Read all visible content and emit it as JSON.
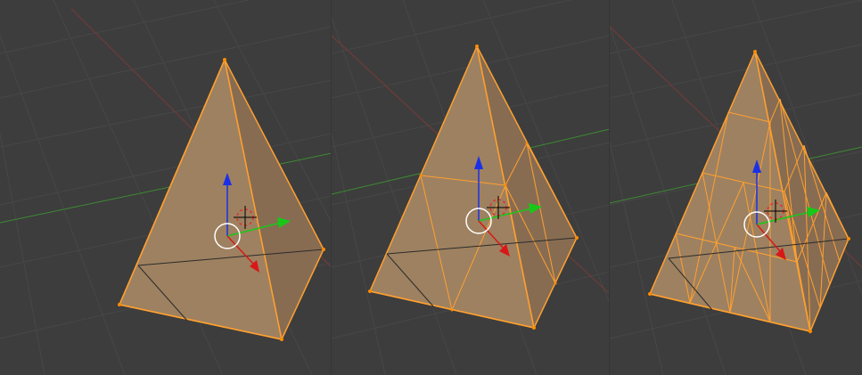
{
  "viewports": [
    {
      "id": "viewport-1",
      "subdivision_level": 0
    },
    {
      "id": "viewport-2",
      "subdivision_level": 1
    },
    {
      "id": "viewport-3",
      "subdivision_level": 2
    }
  ],
  "colors": {
    "background": "#3d3d3d",
    "grid": "#484848",
    "x_axis_line": "#7a3a3a",
    "y_axis_line": "#3d8a32",
    "face_fill": "#9e8160",
    "face_dark": "#876c52",
    "edge_selected": "#ffa030",
    "vertex": "#ff8c00",
    "gizmo_x": "#d81818",
    "gizmo_y": "#18c818",
    "gizmo_z": "#1a30e8",
    "cursor_red": "#e03030",
    "cursor_white": "#ffffff"
  },
  "icons": {
    "transform_gizmo": "translate-gizmo-icon",
    "pivot": "pivot-circle-icon",
    "cursor": "3d-cursor-icon"
  }
}
